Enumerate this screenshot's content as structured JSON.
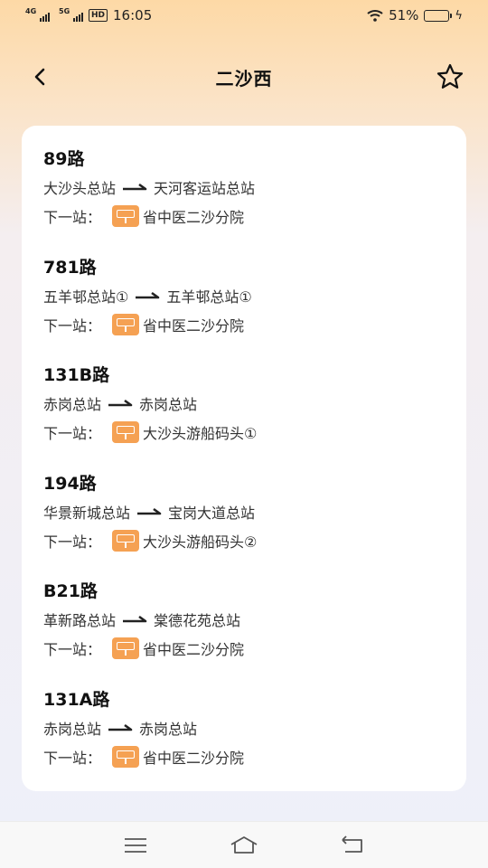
{
  "status_bar": {
    "sim1": "4G",
    "sim2": "5G",
    "hd": "HD",
    "time": "16:05",
    "battery_text": "51%",
    "battery_level": 0.51
  },
  "header": {
    "title": "二沙西",
    "back_icon": "chevron-left-icon",
    "favorite_icon": "star-outline-icon"
  },
  "next_label": "下一站：",
  "routes": [
    {
      "name": "89路",
      "from": "大沙头总站",
      "to": "天河客运站总站",
      "next_stop": "省中医二沙分院"
    },
    {
      "name": "781路",
      "from": "五羊邨总站①",
      "to": "五羊邨总站①",
      "next_stop": "省中医二沙分院"
    },
    {
      "name": "131B路",
      "from": "赤岗总站",
      "to": "赤岗总站",
      "next_stop": "大沙头游船码头①"
    },
    {
      "name": "194路",
      "from": "华景新城总站",
      "to": "宝岗大道总站",
      "next_stop": "大沙头游船码头②"
    },
    {
      "name": "B21路",
      "from": "革新路总站",
      "to": "棠德花苑总站",
      "next_stop": "省中医二沙分院"
    },
    {
      "name": "131A路",
      "from": "赤岗总站",
      "to": "赤岗总站",
      "next_stop": "省中医二沙分院"
    }
  ],
  "colors": {
    "stop_icon": "#f5a153",
    "header_gradient_top": "#fdd9a6",
    "background": "#eef0fa"
  },
  "nav_bar": {
    "menu_icon": "menu-icon",
    "home_icon": "home-icon",
    "back_icon": "back-icon"
  }
}
